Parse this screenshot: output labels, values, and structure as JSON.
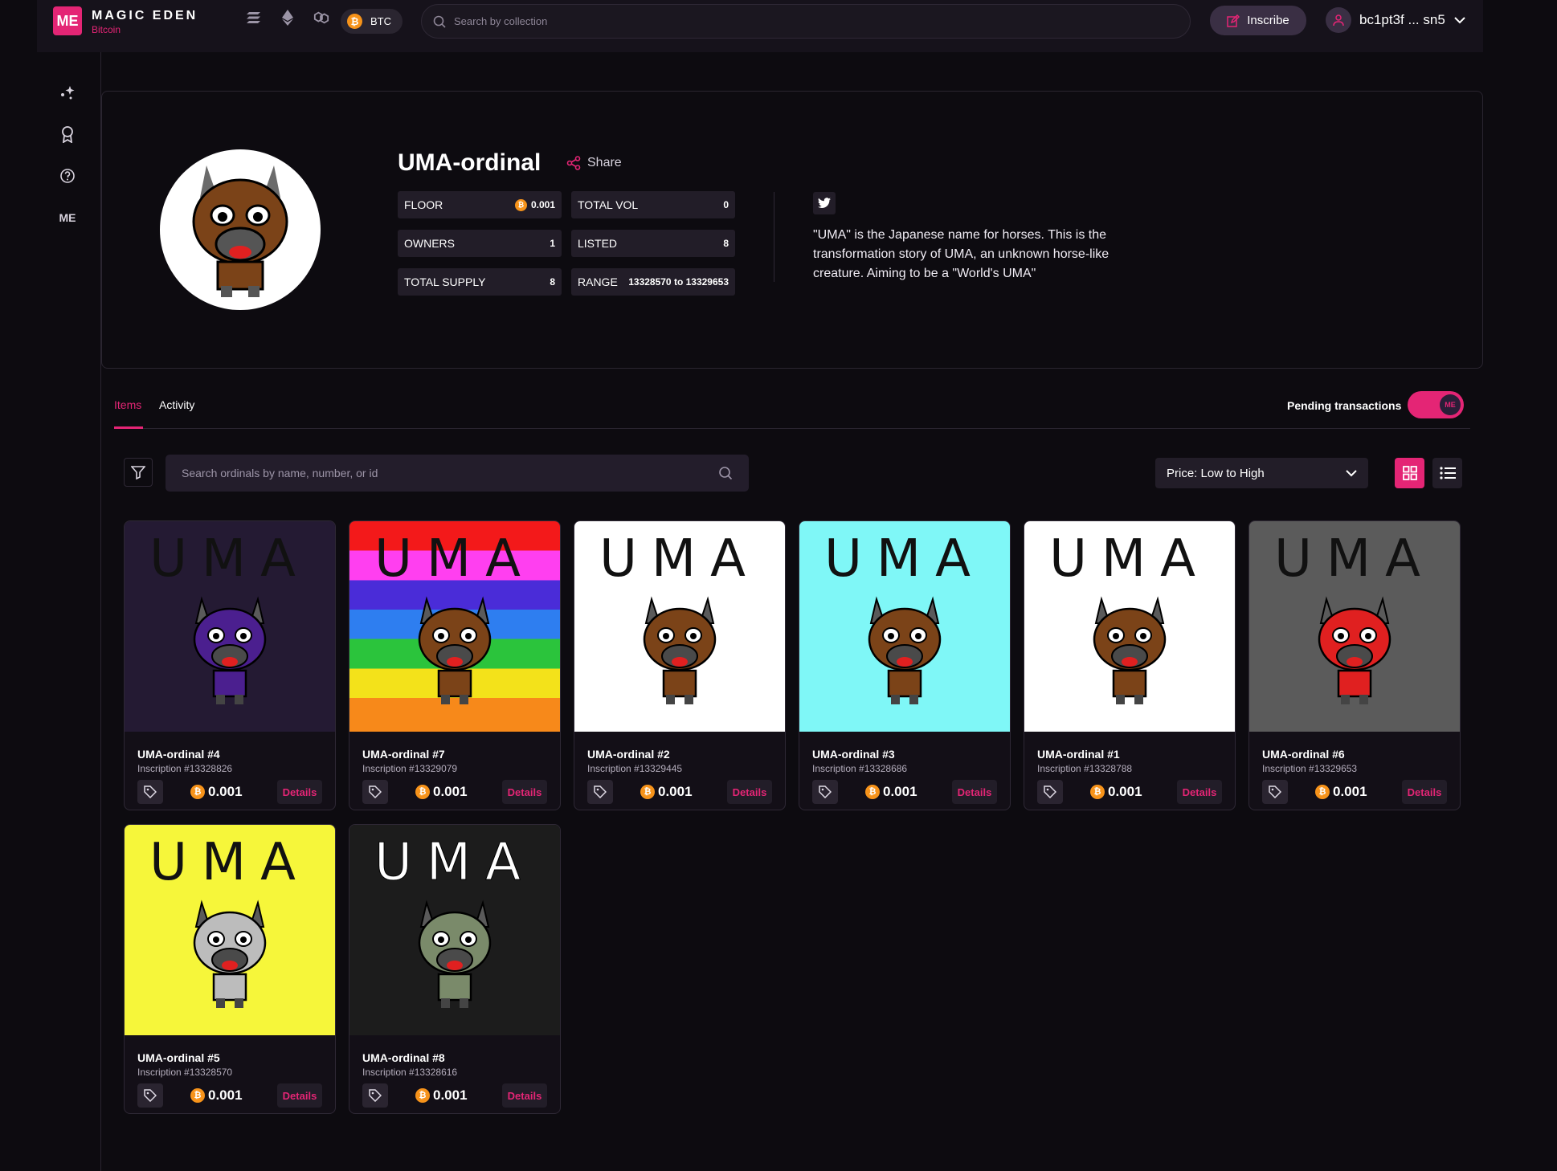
{
  "topbar": {
    "brand_name": "MAGIC EDEN",
    "brand_sub": "Bitcoin",
    "logo_text": "ME",
    "chain_label": "BTC",
    "search_placeholder": "Search by collection",
    "inscribe_label": "Inscribe",
    "wallet": "bc1pt3f ... sn5"
  },
  "collection": {
    "title": "UMA-ordinal",
    "share_label": "Share",
    "stats": {
      "floor_label": "FLOOR",
      "floor_value": "0.001",
      "total_vol_label": "TOTAL VOL",
      "total_vol_value": "0",
      "owners_label": "OWNERS",
      "owners_value": "1",
      "listed_label": "LISTED",
      "listed_value": "8",
      "supply_label": "TOTAL SUPPLY",
      "supply_value": "8",
      "range_label": "RANGE",
      "range_value": "13328570 to 13329653"
    },
    "description": "\"UMA\" is the Japanese name for horses. This is the transformation story of UMA, an unknown horse-like creature. Aiming to be a \"World's UMA\""
  },
  "tabs": {
    "items_label": "Items",
    "activity_label": "Activity",
    "pending_label": "Pending transactions",
    "toggle_badge": "ME"
  },
  "filters": {
    "search_placeholder": "Search ordinals by name, number, or id",
    "sort_value": "Price: Low to High"
  },
  "items": [
    {
      "name": "UMA-ordinal #4",
      "inscription": "Inscription #13328826",
      "price": "0.001",
      "details": "Details",
      "bg": "#241a33",
      "horse": "#4b1f8f"
    },
    {
      "name": "UMA-ordinal #7",
      "inscription": "Inscription #13329079",
      "price": "0.001",
      "details": "Details",
      "bg": "rainbow",
      "horse": "#7b4318"
    },
    {
      "name": "UMA-ordinal #2",
      "inscription": "Inscription #13329445",
      "price": "0.001",
      "details": "Details",
      "bg": "#ffffff",
      "horse": "#7b4318"
    },
    {
      "name": "UMA-ordinal #3",
      "inscription": "Inscription #13328686",
      "price": "0.001",
      "details": "Details",
      "bg": "#7ff7f7",
      "horse": "#7b4318"
    },
    {
      "name": "UMA-ordinal #1",
      "inscription": "Inscription #13328788",
      "price": "0.001",
      "details": "Details",
      "bg": "#ffffff",
      "horse": "#7b4318"
    },
    {
      "name": "UMA-ordinal #6",
      "inscription": "Inscription #13329653",
      "price": "0.001",
      "details": "Details",
      "bg": "#5b5b5b",
      "horse": "#e02020"
    },
    {
      "name": "UMA-ordinal #5",
      "inscription": "Inscription #13328570",
      "price": "0.001",
      "details": "Details",
      "bg": "#f6f63a",
      "horse": "#bcbcbc"
    },
    {
      "name": "UMA-ordinal #8",
      "inscription": "Inscription #13328616",
      "price": "0.001",
      "details": "Details",
      "bg": "#1c1c1c",
      "horse": "#7a8a6a"
    }
  ],
  "uma_text": "UMA",
  "btc_symbol": "₿",
  "colors": {
    "accent": "#e42575",
    "bitcoin": "#f7931a",
    "background": "#0d0b10"
  }
}
